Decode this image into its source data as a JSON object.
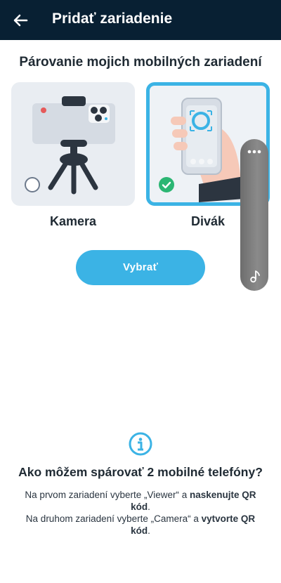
{
  "appbar": {
    "title": "Pridať zariadenie",
    "back_icon": "arrow-left-icon"
  },
  "section": {
    "title": "Párovanie mojich mobilných zariadení"
  },
  "options": [
    {
      "label": "Kamera",
      "selected": false,
      "icon": "tripod-phone-illustration"
    },
    {
      "label": "Divák",
      "selected": true,
      "icon": "hand-holding-phone-illustration"
    }
  ],
  "select_button": {
    "label": "Vybrať"
  },
  "floating_panel": {
    "menu_icon": "more-dots-icon",
    "music_icon": "music-note-icon"
  },
  "help": {
    "icon": "info-icon",
    "title": "Ako môžem spárovať 2 mobilné telefóny?",
    "line1_prefix": "Na prvom zariadení vyberte „Viewer“ a ",
    "line1_bold": "naskenujte QR kód",
    "line1_suffix": ".",
    "line2_prefix": "Na druhom zariadení vyberte „Camera“ a ",
    "line2_bold": "vytvorte QR kód",
    "line2_suffix": "."
  },
  "colors": {
    "appbar": "#082033",
    "accent": "#3bb3e5",
    "check": "#2bb673",
    "card_bg": "#e9edf2"
  }
}
